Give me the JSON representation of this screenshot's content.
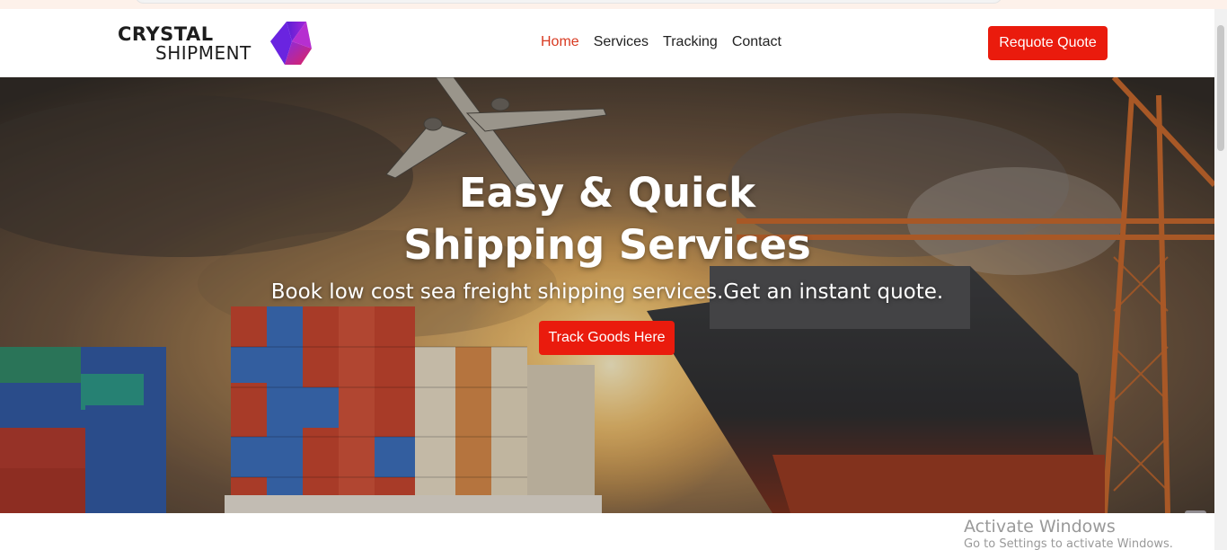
{
  "brand": {
    "name_line1": "CRYSTAL",
    "name_line2": "SHIPMENT",
    "accent_color": "#ea1b0d",
    "logo_colors": [
      "#7b2ff7",
      "#e0245e"
    ]
  },
  "nav": {
    "items": [
      {
        "label": "Home",
        "active": true
      },
      {
        "label": "Services",
        "active": false
      },
      {
        "label": "Tracking",
        "active": false
      },
      {
        "label": "Contact",
        "active": false
      }
    ]
  },
  "header": {
    "quote_button_label": "Requote Quote"
  },
  "hero": {
    "title_line1": "Easy & Quick",
    "title_line2": "Shipping Services",
    "subtitle": "Book low cost sea freight shipping services.Get an instant quote.",
    "cta_label": "Track Goods Here"
  },
  "windows_watermark": {
    "title": "Activate Windows",
    "subtitle": "Go to Settings to activate Windows."
  }
}
